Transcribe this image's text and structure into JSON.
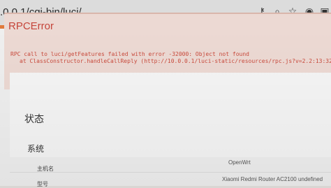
{
  "browser": {
    "url": ".0.0.1/cgi-bin/luci/",
    "icons": [
      "key-icon",
      "search-icon",
      "star-icon",
      "extension-icon",
      "sidebar-icon"
    ]
  },
  "error": {
    "title": "RPCError",
    "line1": "RPC call to luci/getFeatures failed with error -32000: Object not found",
    "line2": "at ClassConstructor.handleCallReply (http://10.0.0.1/luci-static/resources/rpc.js?v=2.2:13:32)"
  },
  "status": {
    "title": "状态",
    "system_title": "系统",
    "rows": [
      {
        "label": "主机名",
        "value": "OpenWrt"
      },
      {
        "label": "型号",
        "value": "Xiaomi Redmi Router AC2100 undefined"
      }
    ]
  },
  "colors": {
    "error_text": "#c5453a",
    "error_bg": "#ecd9d3",
    "stripe_orange": "#e07a3c",
    "stripe_yellow": "#e6c15b"
  }
}
